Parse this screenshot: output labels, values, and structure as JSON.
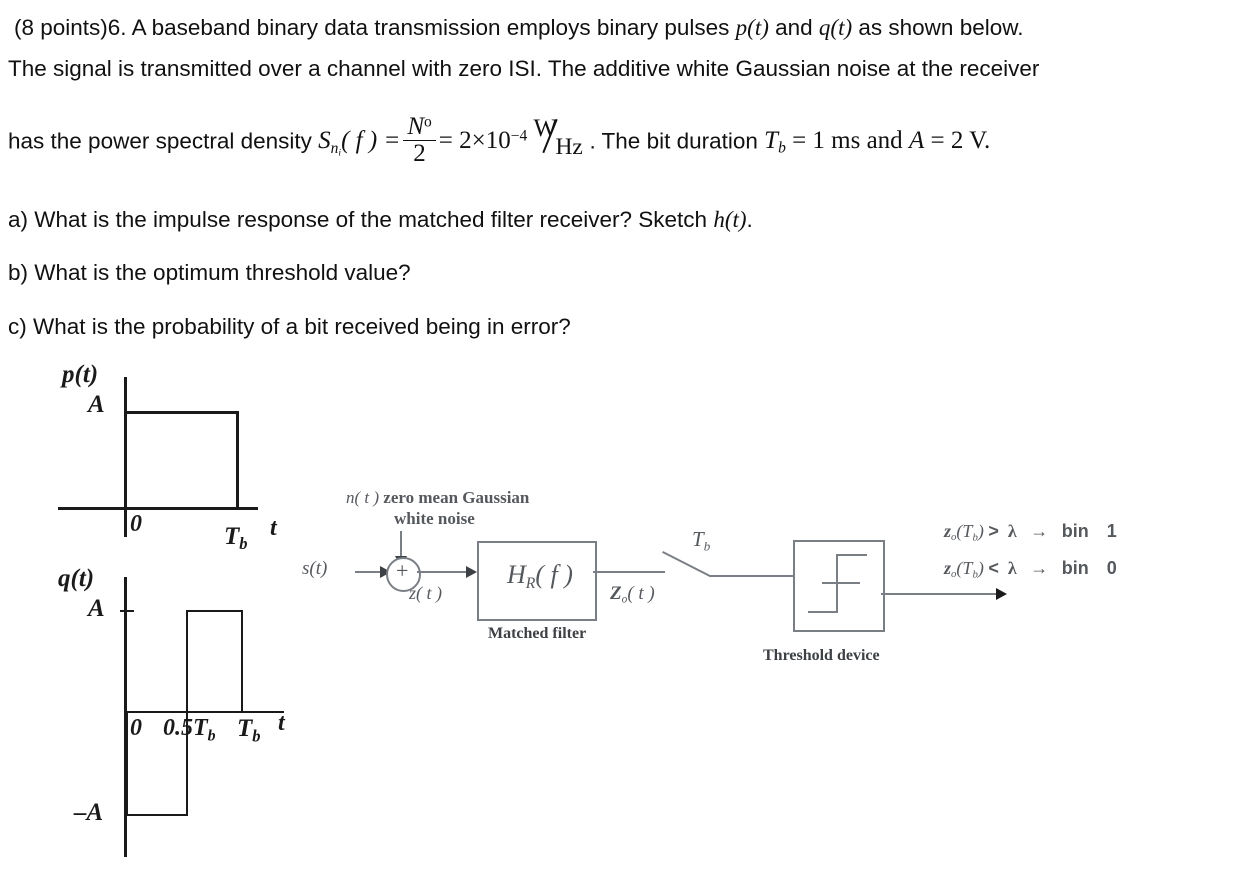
{
  "problem": {
    "line1_a": "(8 points)6. A baseband binary data transmission employs binary pulses ",
    "line1_p": "p(t)",
    "line1_b": " and ",
    "line1_q": "q(t)",
    "line1_c": " as shown below.",
    "line2": "The signal is transmitted over a channel with zero ISI. The additive white Gaussian noise at the receiver",
    "line3_a": "has the power spectral density ",
    "psd_S": "S",
    "psd_sub": "n",
    "psd_subsub": "i",
    "psd_arg": "( f ) =",
    "psd_num": "N",
    "psd_num_sup": "o",
    "psd_den": "2",
    "psd_eq": "= 2×10",
    "psd_exp": "−4",
    "psd_unit_num": "W",
    "psd_unit_den": "Hz",
    "line3_b": ". The bit duration ",
    "tb_sym": "T",
    "tb_sub": "b",
    "tb_val": " = 1 ms and ",
    "a_sym": "A",
    "a_val": " = 2 V."
  },
  "questions": {
    "a_text": "a) What is the impulse response of the matched filter receiver? Sketch ",
    "a_math": "h(t)",
    "a_end": ".",
    "b": "b) What is the optimum threshold value?",
    "c": "c) What is the probability of a bit received being in error?"
  },
  "chart_data": [
    {
      "type": "line",
      "name": "p(t) pulse",
      "title": "p(t)",
      "ylabel_top": "A",
      "xlabel": "t",
      "xticks": [
        "0",
        "Tb"
      ],
      "xtick_sub": [
        "",
        "b"
      ],
      "description": "Rectangular pulse of amplitude A from t=0 to t=Tb, zero elsewhere",
      "x": [
        0,
        0,
        1,
        1
      ],
      "y": [
        0,
        1,
        1,
        0
      ],
      "ylim": [
        0,
        1
      ],
      "xlim": [
        0,
        1
      ]
    },
    {
      "type": "line",
      "name": "q(t) pulse",
      "title": "q(t)",
      "ylabel_top": "A",
      "ylabel_bottom": "–A",
      "xlabel": "t",
      "xticks": [
        "0",
        "0.5Tb",
        "Tb"
      ],
      "description": "Bipolar Manchester pulse: -A from t=0 to t=0.5Tb, then +A from 0.5Tb to Tb",
      "x": [
        0,
        0,
        0.5,
        0.5,
        1,
        1
      ],
      "y": [
        0,
        -1,
        -1,
        1,
        1,
        0
      ],
      "ylim": [
        -1,
        1
      ],
      "xlim": [
        0,
        1
      ]
    }
  ],
  "block_diagram": {
    "noise_label_line1_sym": "n( t )",
    "noise_label_line1_text": "zero mean Gaussian",
    "noise_label_line2_text": "white noise",
    "input_signal": "s(t)",
    "summer_symbol": "+",
    "summer_output": "z( t )",
    "filter_block_H": "H",
    "filter_block_sub": "R",
    "filter_block_arg": "( f )",
    "filter_caption": "Matched filter",
    "filter_output_Z": "Z",
    "filter_output_sub": "o",
    "filter_output_arg": "( t )",
    "sampler_label_T": "T",
    "sampler_label_sub": "b",
    "threshold_caption": "Threshold device",
    "decision_rules": [
      {
        "z": "z",
        "z_sub": "o",
        "arg_open": "(",
        "arg_T": "T",
        "arg_sub": "b",
        "arg_close": ")",
        "relation": ">",
        "threshold": "λ",
        "arrow": "→",
        "result_word": "bin",
        "result_bit": "1"
      },
      {
        "z": "z",
        "z_sub": "o",
        "arg_open": "(",
        "arg_T": "T",
        "arg_sub": "b",
        "arg_close": ")",
        "relation": "<",
        "threshold": "λ",
        "arrow": "→",
        "result_word": "bin",
        "result_bit": "0"
      }
    ]
  },
  "colors": {
    "ink": "#111111",
    "figure_ink": "#1a1a1a",
    "diagram_grey": "#7a7f85",
    "diagram_text": "#55595e"
  }
}
